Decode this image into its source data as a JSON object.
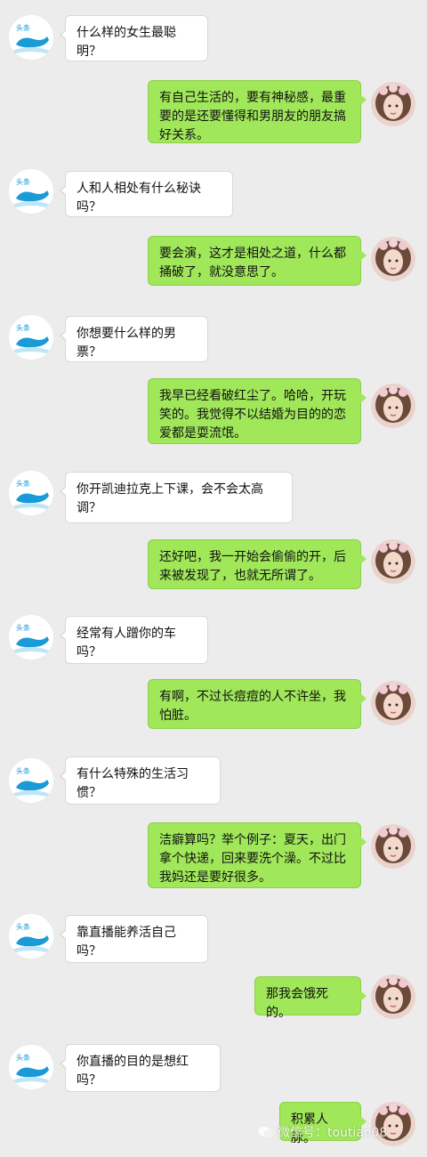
{
  "chat": {
    "messages": [
      {
        "from": "bot",
        "text": "什么样的女生最聪明？"
      },
      {
        "from": "user",
        "text": "有自己生活的，要有神秘感，最重要的是还要懂得和男朋友的朋友搞好关系。"
      },
      {
        "from": "bot",
        "text": "人和人相处有什么秘诀吗？"
      },
      {
        "from": "user",
        "text": "要会演，这才是相处之道，什么都捅破了，就没意思了。"
      },
      {
        "from": "bot",
        "text": "你想要什么样的男票？"
      },
      {
        "from": "user",
        "text": "我早已经看破红尘了。哈哈，开玩笑的。我觉得不以结婚为目的的恋爱都是耍流氓。"
      },
      {
        "from": "bot",
        "text": "你开凯迪拉克上下课，会不会太高调？"
      },
      {
        "from": "user",
        "text": "还好吧，我一开始会偷偷的开，后来被发现了，也就无所谓了。"
      },
      {
        "from": "bot",
        "text": "经常有人蹭你的车吗？"
      },
      {
        "from": "user",
        "text": "有啊，不过长痘痘的人不许坐，我怕脏。"
      },
      {
        "from": "bot",
        "text": "有什么特殊的生活习惯？"
      },
      {
        "from": "user",
        "text": "洁癖算吗？举个例子：夏天，出门拿个快递，回来要洗个澡。不过比我妈还是要好很多。"
      },
      {
        "from": "bot",
        "text": "靠直播能养活自己吗？"
      },
      {
        "from": "user",
        "text": "那我会饿死的。"
      },
      {
        "from": "bot",
        "text": "你直播的目的是想红吗？"
      },
      {
        "from": "user",
        "text": "积累人脉。"
      }
    ]
  },
  "bot_avatar": {
    "icon": "whale-logo-icon",
    "logo_text": "头条",
    "colors": {
      "blue": "#1a9ad6",
      "light": "#bfe6f7"
    }
  },
  "user_avatar": {
    "icon": "girl-portrait-avatar",
    "colors": {
      "hair": "#6b4a3a",
      "skin": "#f3d9cc",
      "flower": "#f2c9d3"
    }
  },
  "watermark": {
    "text": "微信号：toutiao08"
  },
  "colors": {
    "background": "#ececec",
    "user_bubble": "#a0e75a",
    "bot_bubble": "#ffffff"
  }
}
